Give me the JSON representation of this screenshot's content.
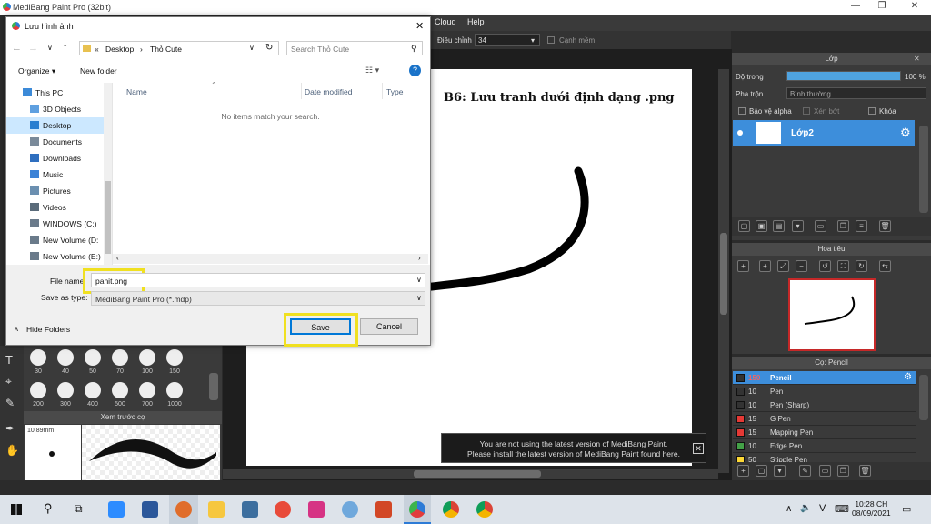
{
  "app": {
    "title": "MediBang Paint Pro (32bit)"
  },
  "menu": [
    "Cloud",
    "Help"
  ],
  "toolbar": {
    "adjust_label": "Điều chỉnh",
    "adjust_value": "34",
    "smooth_label": "Cạnh mềm"
  },
  "canvas": {
    "note": "B6: Lưu tranh dưới định dạng .png"
  },
  "layers_panel": {
    "title": "Lớp",
    "opacity_label": "Độ trong",
    "opacity_value": "100 %",
    "opacity_level": 1.0,
    "blend_label": "Pha trộn",
    "blend_value": "Bình thường",
    "protect_alpha": "Bảo vệ alpha",
    "clip": "Xén bớt",
    "lock": "Khóa",
    "layer_name": "Lớp2"
  },
  "navigator": {
    "title": "Hoa tiêu"
  },
  "brush_panel": {
    "title": "Cọ: Pencil",
    "brushes": [
      {
        "size": "150",
        "name": "Pencil",
        "color": "#333333"
      },
      {
        "size": "10",
        "name": "Pen",
        "color": "#333333"
      },
      {
        "size": "10",
        "name": "Pen (Sharp)",
        "color": "#333333"
      },
      {
        "size": "15",
        "name": "G Pen",
        "color": "#e53935"
      },
      {
        "size": "15",
        "name": "Mapping Pen",
        "color": "#e53935"
      },
      {
        "size": "10",
        "name": "Edge Pen",
        "color": "#43a047"
      },
      {
        "size": "50",
        "name": "Stipple Pen",
        "color": "#fdd835"
      }
    ]
  },
  "brush_sizes": {
    "row1": [
      "30",
      "40",
      "50",
      "70",
      "100",
      "150"
    ],
    "row2": [
      "200",
      "300",
      "400",
      "500",
      "700",
      "1000"
    ]
  },
  "preview": {
    "title": "Xem trước cọ",
    "size": "10.89mm"
  },
  "notice": {
    "line1": "You are not using the latest version of MediBang Paint.",
    "line2": "Please install the latest version of MediBang Paint found here."
  },
  "dialog": {
    "title": "Lưu hình ảnh",
    "breadcrumb": [
      "«",
      "Desktop",
      "›",
      "Thỏ Cute"
    ],
    "search_placeholder": "Search Thỏ Cute",
    "organize": "Organize ▾",
    "new_folder": "New folder",
    "nav": [
      "This PC",
      "3D Objects",
      "Desktop",
      "Documents",
      "Downloads",
      "Music",
      "Pictures",
      "Videos",
      "WINDOWS (C:)",
      "New Volume (D:",
      "New Volume (E:)"
    ],
    "columns": [
      "Name",
      "Date modified",
      "Type"
    ],
    "empty": "No items match your search.",
    "file_name_label": "File name:",
    "file_name_value": "panit.png",
    "save_type_label": "Save as type:",
    "save_type_value": "MediBang Paint Pro (*.mdp)",
    "hide_folders": "Hide Folders",
    "save": "Save",
    "cancel": "Cancel"
  },
  "taskbar": {
    "time": "10:28 CH",
    "date": "08/09/2021",
    "lang": "V"
  }
}
